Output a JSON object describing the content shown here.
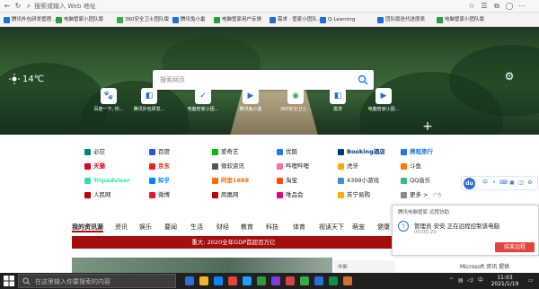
{
  "browser": {
    "address_placeholder": "搜索或输入 Web 地址",
    "bookmarks": [
      {
        "label": "腾讯外包研发管理...",
        "color": "#1f6fd6"
      },
      {
        "label": "电脑管家小团队版",
        "color": "#2e9c3b"
      },
      {
        "label": "360安全卫士团队版",
        "color": "#3aa94a"
      },
      {
        "label": "腾讯兔小巢",
        "color": "#1f6fd6"
      },
      {
        "label": "电脑管家用户反馈",
        "color": "#2e9c3b"
      },
      {
        "label": "需求 · 管家小团队...",
        "color": "#1f6fd6"
      },
      {
        "label": "Q-Learning",
        "color": "#1f6fd6"
      },
      {
        "label": "团队版迭代进度表",
        "color": "#1f6fd6"
      },
      {
        "label": "电脑管家小团队版",
        "color": "#2e9c3b"
      }
    ]
  },
  "hero": {
    "temperature": "14℃",
    "search_placeholder": "搜索网页",
    "tiles": [
      {
        "label": "百度一下, 你...",
        "color": "#2a55d6",
        "glyph": "🐾"
      },
      {
        "label": "腾讯外包研发...",
        "color": "#1f6fd6",
        "glyph": "◧"
      },
      {
        "label": "电脑管家小团...",
        "color": "#1f6fd6",
        "glyph": "✓"
      },
      {
        "label": "腾讯兔小巢",
        "color": "#1f6fd6",
        "glyph": "▶"
      },
      {
        "label": "360安全卫士...",
        "color": "#3aa94a",
        "glyph": "◉"
      },
      {
        "label": "需求",
        "color": "#1f6fd6",
        "glyph": "◧"
      },
      {
        "label": "电脑管家小团...",
        "color": "#1f6fd6",
        "glyph": "▶"
      }
    ]
  },
  "links": [
    {
      "label": "必应",
      "color": "#008373"
    },
    {
      "label": "百度",
      "color": "#2a55d6"
    },
    {
      "label": "爱奇艺",
      "color": "#00be06"
    },
    {
      "label": "优酷",
      "color": "#1e7cf0"
    },
    {
      "label": "Booking酒店",
      "color": "#003580"
    },
    {
      "label": "携程旅行",
      "color": "#2577e3"
    },
    {
      "label": "天猫",
      "color": "#e0001b"
    },
    {
      "label": "京东",
      "color": "#e1251b"
    },
    {
      "label": "微软资讯",
      "color": "#555555"
    },
    {
      "label": "哔哩哔哩",
      "color": "#fb7299"
    },
    {
      "label": "虎牙",
      "color": "#ffa800"
    },
    {
      "label": "斗鱼",
      "color": "#ff7700"
    },
    {
      "label": "Tripadvisor",
      "color": "#34e0a1"
    },
    {
      "label": "知乎",
      "color": "#0084ff"
    },
    {
      "label": "阿里1688",
      "color": "#ff6a00"
    },
    {
      "label": "淘宝",
      "color": "#ff5000"
    },
    {
      "label": "4399小游戏",
      "color": "#3b8cd6"
    },
    {
      "label": "QQ音乐",
      "color": "#31c27c"
    },
    {
      "label": "人民网",
      "color": "#c00000"
    },
    {
      "label": "微博",
      "color": "#e6162d"
    },
    {
      "label": "凤凰网",
      "color": "#c00000"
    },
    {
      "label": "唯品会",
      "color": "#e4007f"
    },
    {
      "label": "苏宁易购",
      "color": "#ffaa00"
    },
    {
      "label": "更多 >",
      "color": "#888888"
    }
  ],
  "ad_label": "广告",
  "baidu_bar": {
    "logo": "du",
    "keys": [
      "中",
      "•",
      "⌨",
      "▣",
      "◫",
      "⚙"
    ]
  },
  "tabs": [
    {
      "label": "我的资讯源",
      "active": true
    },
    {
      "label": "资讯"
    },
    {
      "label": "娱乐"
    },
    {
      "label": "要闻"
    },
    {
      "label": "生活"
    },
    {
      "label": "财经"
    },
    {
      "label": "教育"
    },
    {
      "label": "科技"
    },
    {
      "label": "体育"
    },
    {
      "label": "视读天下"
    },
    {
      "label": "萌宠"
    },
    {
      "label": "健康"
    }
  ],
  "headline": "重大: 2020全年GDP首超百万亿",
  "news_side": "中新",
  "popup": {
    "title": "腾讯电脑管家-远程协助",
    "message": "管理员 安安 正在远程控制该电脑",
    "time": "00:00:20",
    "stop_label": "结束远程"
  },
  "ms_row": "Microsoft 资讯 提供",
  "taskbar": {
    "search_placeholder": "在这里输入你要搜索的内容",
    "time": "11:03",
    "date": "2021/1/19",
    "apps": [
      {
        "color": "#2b6fd8"
      },
      {
        "color": "#f2b32e"
      },
      {
        "color": "#0a84ff"
      },
      {
        "color": "#e2453c"
      },
      {
        "color": "#1e9fff"
      },
      {
        "color": "#2e9c3b"
      },
      {
        "color": "#7a3fd6"
      },
      {
        "color": "#d64545"
      },
      {
        "color": "#3aa94a"
      },
      {
        "color": "#2b6fd8"
      },
      {
        "color": "#0f8f4a"
      },
      {
        "color": "#d66f2b"
      }
    ]
  }
}
